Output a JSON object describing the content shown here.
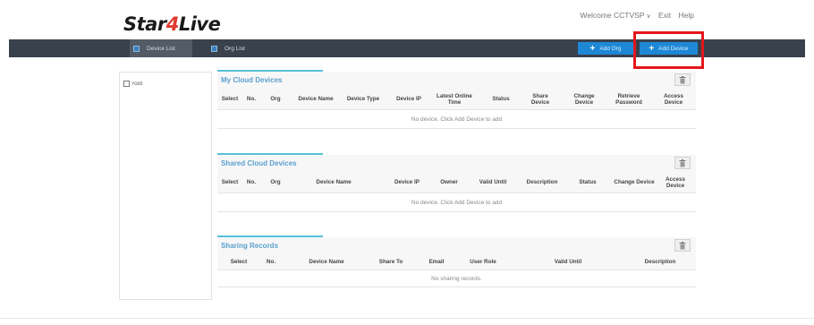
{
  "app": {
    "logo_main": "Star",
    "logo_num": "4",
    "logo_tail": "Live"
  },
  "user": {
    "welcome": "Welcome CCTVSP",
    "exit": "Exit",
    "help": "Help"
  },
  "nav": {
    "tabs": [
      {
        "label": "Device List"
      },
      {
        "label": "Org List"
      }
    ],
    "add_org": "Add Org",
    "add_device": "Add Device"
  },
  "tree": {
    "root": "root"
  },
  "my_devices": {
    "title": "My Cloud Devices",
    "columns": [
      "Select",
      "No.",
      "Org",
      "Device Name",
      "Device Type",
      "Device IP",
      "Latest Online Time",
      "Status",
      "Share Device",
      "Change Device",
      "Retrieve Password",
      "Access Device"
    ],
    "empty": "No device. Click Add Device to add"
  },
  "shared_devices": {
    "title": "Shared Cloud Devices",
    "columns": [
      "Select",
      "No.",
      "Org",
      "Device Name",
      "Device IP",
      "Owner",
      "Valid Until",
      "Description",
      "Status",
      "Change Device",
      "Access Device"
    ],
    "empty": "No device. Click Add Device to add"
  },
  "sharing_records": {
    "title": "Sharing Records",
    "columns": [
      "Select",
      "No.",
      "Device Name",
      "Share To",
      "Email",
      "User Role",
      "Valid Until",
      "Description"
    ],
    "empty": "No sharing records."
  },
  "colors": {
    "navbar": "#39414c",
    "accent": "#1e88d6",
    "title": "#5aa0cf",
    "highlight": "#e4161c",
    "logo_red": "#e03a2f"
  },
  "icons": {
    "list": "list-icon",
    "plus": "plus-icon",
    "trash": "trash-icon",
    "chevron": "chevron-down-icon"
  }
}
